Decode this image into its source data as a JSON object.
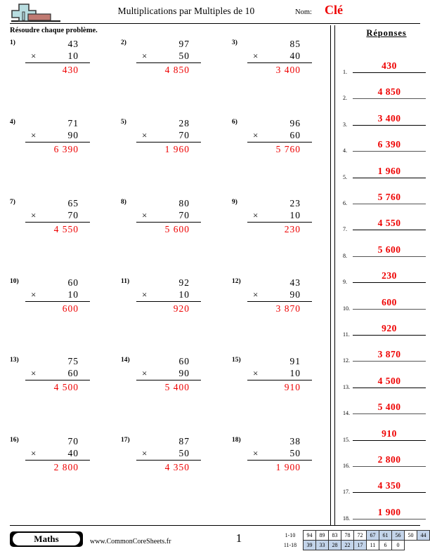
{
  "header": {
    "title": "Multiplications par Multiples de 10",
    "name_label": "Nom:",
    "name_value": "Clé",
    "logo_name": "math-plus-logo"
  },
  "instruction": "Résoudre chaque problème.",
  "answers_header": "Réponses",
  "problems": [
    {
      "num": "1)",
      "a": "43",
      "op": "×",
      "b": "10",
      "product": "430"
    },
    {
      "num": "2)",
      "a": "97",
      "op": "×",
      "b": "50",
      "product": "4 850"
    },
    {
      "num": "3)",
      "a": "85",
      "op": "×",
      "b": "40",
      "product": "3 400"
    },
    {
      "num": "4)",
      "a": "71",
      "op": "×",
      "b": "90",
      "product": "6 390"
    },
    {
      "num": "5)",
      "a": "28",
      "op": "×",
      "b": "70",
      "product": "1 960"
    },
    {
      "num": "6)",
      "a": "96",
      "op": "×",
      "b": "60",
      "product": "5 760"
    },
    {
      "num": "7)",
      "a": "65",
      "op": "×",
      "b": "70",
      "product": "4 550"
    },
    {
      "num": "8)",
      "a": "80",
      "op": "×",
      "b": "70",
      "product": "5 600"
    },
    {
      "num": "9)",
      "a": "23",
      "op": "×",
      "b": "10",
      "product": "230"
    },
    {
      "num": "10)",
      "a": "60",
      "op": "×",
      "b": "10",
      "product": "600"
    },
    {
      "num": "11)",
      "a": "92",
      "op": "×",
      "b": "10",
      "product": "920"
    },
    {
      "num": "12)",
      "a": "43",
      "op": "×",
      "b": "90",
      "product": "3 870"
    },
    {
      "num": "13)",
      "a": "75",
      "op": "×",
      "b": "60",
      "product": "4 500"
    },
    {
      "num": "14)",
      "a": "60",
      "op": "×",
      "b": "90",
      "product": "5 400"
    },
    {
      "num": "15)",
      "a": "91",
      "op": "×",
      "b": "10",
      "product": "910"
    },
    {
      "num": "16)",
      "a": "70",
      "op": "×",
      "b": "40",
      "product": "2 800"
    },
    {
      "num": "17)",
      "a": "87",
      "op": "×",
      "b": "50",
      "product": "4 350"
    },
    {
      "num": "18)",
      "a": "38",
      "op": "×",
      "b": "50",
      "product": "1 900"
    }
  ],
  "answers": [
    {
      "num": "1.",
      "value": "430"
    },
    {
      "num": "2.",
      "value": "4 850"
    },
    {
      "num": "3.",
      "value": "3 400"
    },
    {
      "num": "4.",
      "value": "6 390"
    },
    {
      "num": "5.",
      "value": "1 960"
    },
    {
      "num": "6.",
      "value": "5 760"
    },
    {
      "num": "7.",
      "value": "4 550"
    },
    {
      "num": "8.",
      "value": "5 600"
    },
    {
      "num": "9.",
      "value": "230"
    },
    {
      "num": "10.",
      "value": "600"
    },
    {
      "num": "11.",
      "value": "920"
    },
    {
      "num": "12.",
      "value": "3 870"
    },
    {
      "num": "13.",
      "value": "4 500"
    },
    {
      "num": "14.",
      "value": "5 400"
    },
    {
      "num": "15.",
      "value": "910"
    },
    {
      "num": "16.",
      "value": "2 800"
    },
    {
      "num": "17.",
      "value": "4 350"
    },
    {
      "num": "18.",
      "value": "1 900"
    }
  ],
  "footer": {
    "badge_label": "Maths",
    "website": "www.CommonCoreSheets.fr",
    "page_number": "1"
  },
  "score_table": {
    "row1_label": "1-10",
    "row2_label": "11-18",
    "row1": [
      {
        "value": "94",
        "shaded": false
      },
      {
        "value": "89",
        "shaded": false
      },
      {
        "value": "83",
        "shaded": false
      },
      {
        "value": "78",
        "shaded": false
      },
      {
        "value": "72",
        "shaded": false
      },
      {
        "value": "67",
        "shaded": true
      },
      {
        "value": "61",
        "shaded": true
      },
      {
        "value": "56",
        "shaded": true
      },
      {
        "value": "50",
        "shaded": false
      },
      {
        "value": "44",
        "shaded": true
      }
    ],
    "row2": [
      {
        "value": "39",
        "shaded": true
      },
      {
        "value": "33",
        "shaded": true
      },
      {
        "value": "28",
        "shaded": true
      },
      {
        "value": "22",
        "shaded": true
      },
      {
        "value": "17",
        "shaded": true
      },
      {
        "value": "11",
        "shaded": false
      },
      {
        "value": "6",
        "shaded": false
      },
      {
        "value": "0",
        "shaded": false
      }
    ]
  },
  "colors": {
    "answer_red": "#ee0000",
    "shade_blue": "#c3d4ea",
    "logo_plus": "#b8dde0",
    "logo_block": "#c07a72"
  }
}
